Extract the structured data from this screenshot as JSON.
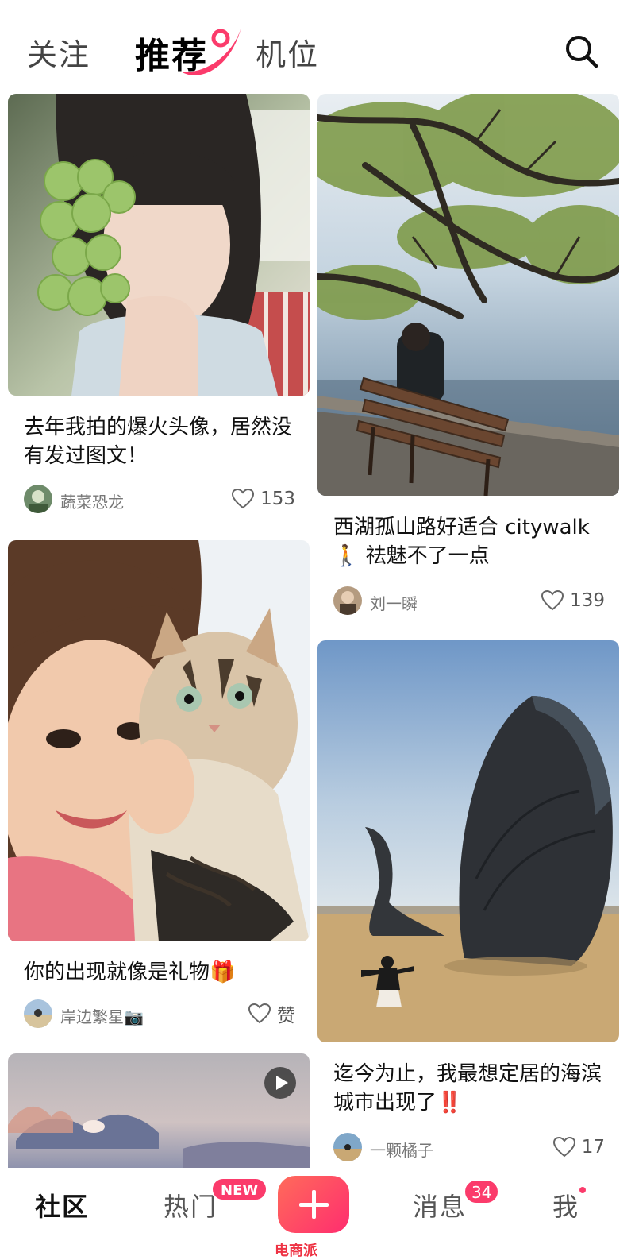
{
  "header": {
    "tabs": [
      {
        "label": "关注"
      },
      {
        "label": "推荐"
      },
      {
        "label": "机位"
      }
    ]
  },
  "colors": {
    "accent": "#fb3b6b",
    "plus_gradient_start": "#ff6b5a",
    "plus_gradient_end": "#ff2d6f"
  },
  "feed": {
    "left": [
      {
        "title": "去年我拍的爆火头像，居然没有发过图文！",
        "author": "蔬菜恐龙",
        "likes": "153"
      },
      {
        "title": "你的出现就像是礼物🎁",
        "author": "岸边繁星📷",
        "likes": "赞"
      },
      {
        "title": "",
        "author": "",
        "likes": ""
      }
    ],
    "right": [
      {
        "title": "西湖孤山路好适合 citywalk 🚶 祛魅不了一点",
        "author": "刘一瞬",
        "likes": "139"
      },
      {
        "title": "迄今为止，我最想定居的海滨城市出现了‼️",
        "author": "一颗橘子",
        "likes": "17"
      }
    ]
  },
  "bottom_nav": {
    "items": [
      {
        "label": "社区"
      },
      {
        "label": "热门"
      },
      {
        "label": "消息"
      },
      {
        "label": "我"
      }
    ],
    "new_badge": "NEW",
    "message_count": "34",
    "watermark": "电商派"
  },
  "icons": [
    "search-icon",
    "heart-icon",
    "play-icon",
    "plus-icon"
  ]
}
